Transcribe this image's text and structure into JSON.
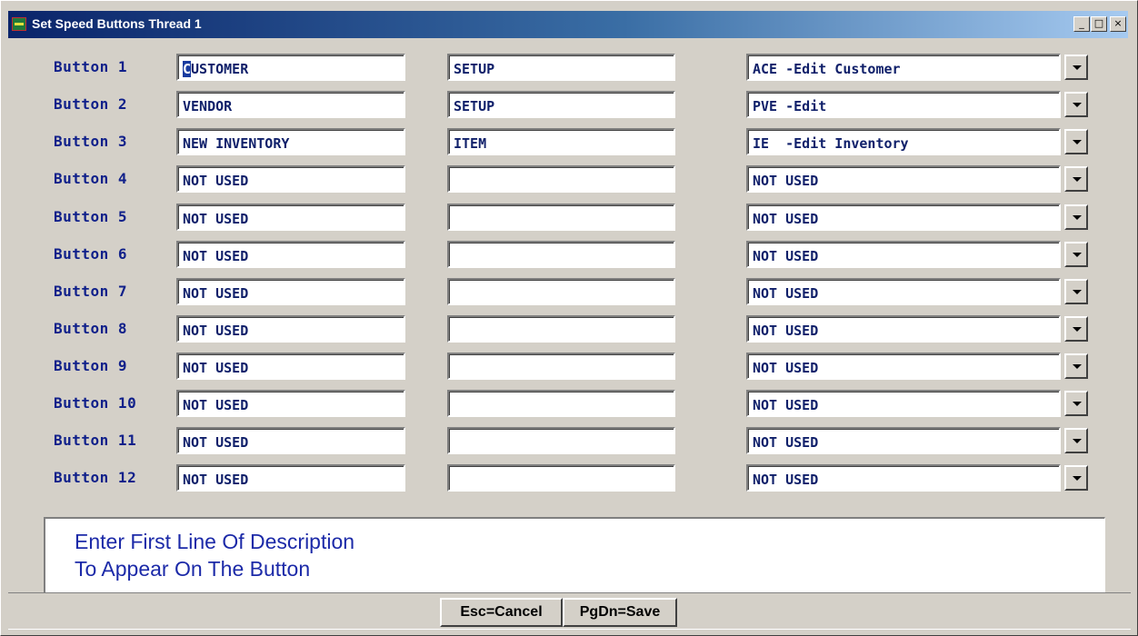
{
  "window": {
    "title": "Set Speed Buttons Thread 1",
    "controls": {
      "minimize": "_",
      "maximize": "□",
      "close": "×"
    }
  },
  "rows": [
    {
      "label": "Button  1",
      "line1": "CUSTOMER",
      "line2": "SETUP",
      "program": "ACE -Edit Customer"
    },
    {
      "label": "Button  2",
      "line1": "VENDOR",
      "line2": "SETUP",
      "program": "PVE -Edit"
    },
    {
      "label": "Button  3",
      "line1": "NEW INVENTORY",
      "line2": "ITEM",
      "program": "IE  -Edit Inventory"
    },
    {
      "label": "Button  4",
      "line1": "NOT USED",
      "line2": "",
      "program": "NOT USED"
    },
    {
      "label": "Button  5",
      "line1": "NOT USED",
      "line2": "",
      "program": "NOT USED"
    },
    {
      "label": "Button  6",
      "line1": "NOT USED",
      "line2": "",
      "program": "NOT USED"
    },
    {
      "label": "Button  7",
      "line1": "NOT USED",
      "line2": "",
      "program": "NOT USED"
    },
    {
      "label": "Button  8",
      "line1": "NOT USED",
      "line2": "",
      "program": "NOT USED"
    },
    {
      "label": "Button  9",
      "line1": "NOT USED",
      "line2": "",
      "program": "NOT USED"
    },
    {
      "label": "Button 10",
      "line1": "NOT USED",
      "line2": "",
      "program": "NOT USED"
    },
    {
      "label": "Button 11",
      "line1": "NOT USED",
      "line2": "",
      "program": "NOT USED"
    },
    {
      "label": "Button 12",
      "line1": "NOT USED",
      "line2": "",
      "program": "NOT USED"
    }
  ],
  "description": {
    "line1": "Enter First Line Of Description",
    "line2": "To Appear On The Button"
  },
  "footer": {
    "cancel_label": "Esc=Cancel",
    "save_label": "PgDn=Save"
  }
}
